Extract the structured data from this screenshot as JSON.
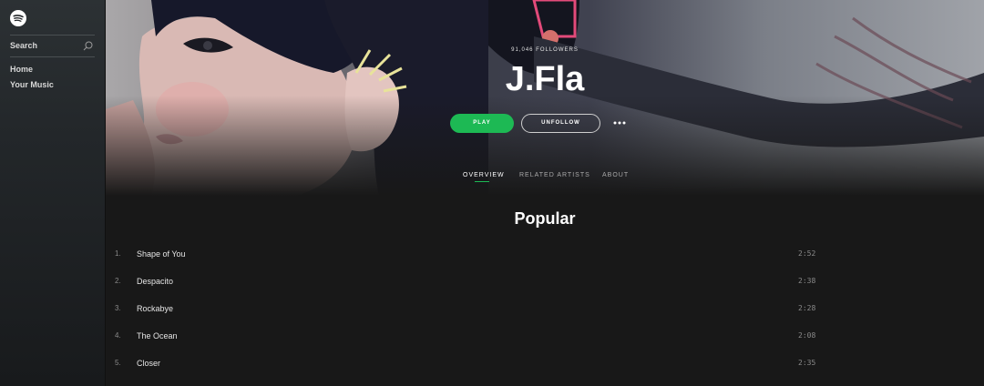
{
  "sidebar": {
    "logo_icon": "spotify-logo-icon",
    "search_label": "Search",
    "search_icon": "search-icon",
    "nav": [
      {
        "label": "Home"
      },
      {
        "label": "Your Music"
      }
    ]
  },
  "artist": {
    "followers": "91,046 FOLLOWERS",
    "name": "J.Fla",
    "play_label": "PLAY",
    "unfollow_label": "UNFOLLOW",
    "more_icon": "more-options-icon"
  },
  "tabs": [
    {
      "label": "OVERVIEW",
      "active": true
    },
    {
      "label": "RELATED ARTISTS",
      "active": false
    },
    {
      "label": "ABOUT",
      "active": false
    }
  ],
  "popular": {
    "title": "Popular",
    "tracks": [
      {
        "num": "1.",
        "title": "Shape of You",
        "duration": "2:52"
      },
      {
        "num": "2.",
        "title": "Despacito",
        "duration": "2:38"
      },
      {
        "num": "3.",
        "title": "Rockabye",
        "duration": "2:28"
      },
      {
        "num": "4.",
        "title": "The Ocean",
        "duration": "2:08"
      },
      {
        "num": "5.",
        "title": "Closer",
        "duration": "2:35"
      }
    ]
  },
  "colors": {
    "accent": "#1db954",
    "background": "#181818",
    "sidebar": "#23272a"
  }
}
